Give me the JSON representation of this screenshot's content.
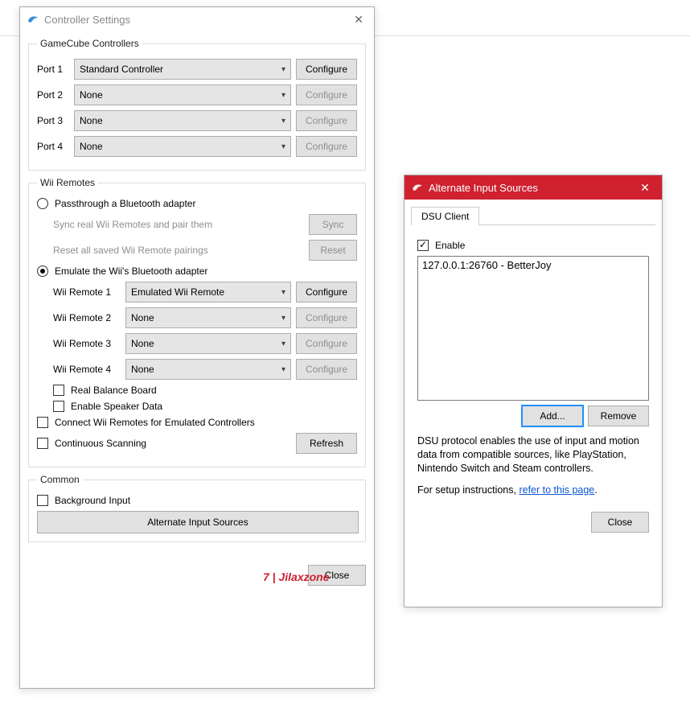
{
  "watermark": "7 | Jilaxzone",
  "leftWindow": {
    "title": "Controller Settings",
    "groups": {
      "gamecube": {
        "legend": "GameCube Controllers",
        "ports": [
          {
            "label": "Port 1",
            "value": "Standard Controller",
            "configure": "Configure",
            "enabled": true
          },
          {
            "label": "Port 2",
            "value": "None",
            "configure": "Configure",
            "enabled": false
          },
          {
            "label": "Port 3",
            "value": "None",
            "configure": "Configure",
            "enabled": false
          },
          {
            "label": "Port 4",
            "value": "None",
            "configure": "Configure",
            "enabled": false
          }
        ]
      },
      "wii": {
        "legend": "Wii Remotes",
        "passthrough": {
          "label": "Passthrough a Bluetooth adapter",
          "syncLabel": "Sync real Wii Remotes and pair them",
          "syncBtn": "Sync",
          "resetLabel": "Reset all saved Wii Remote pairings",
          "resetBtn": "Reset"
        },
        "emulate": {
          "label": "Emulate the Wii's Bluetooth adapter",
          "remotes": [
            {
              "label": "Wii Remote 1",
              "value": "Emulated Wii Remote",
              "configure": "Configure",
              "enabled": true
            },
            {
              "label": "Wii Remote 2",
              "value": "None",
              "configure": "Configure",
              "enabled": false
            },
            {
              "label": "Wii Remote 3",
              "value": "None",
              "configure": "Configure",
              "enabled": false
            },
            {
              "label": "Wii Remote 4",
              "value": "None",
              "configure": "Configure",
              "enabled": false
            }
          ],
          "balanceBoard": "Real Balance Board",
          "speakerData": "Enable Speaker Data"
        },
        "connectEmulated": "Connect Wii Remotes for Emulated Controllers",
        "continuousScanning": "Continuous Scanning",
        "refreshBtn": "Refresh"
      },
      "common": {
        "legend": "Common",
        "backgroundInput": "Background Input",
        "altInputBtn": "Alternate Input Sources"
      }
    },
    "closeBtn": "Close"
  },
  "rightWindow": {
    "title": "Alternate Input Sources",
    "tab": "DSU Client",
    "enableLabel": "Enable",
    "listItems": [
      "127.0.0.1:26760 - BetterJoy"
    ],
    "addBtn": "Add...",
    "removeBtn": "Remove",
    "desc1": "DSU protocol enables the use of input and motion data from compatible sources, like PlayStation, Nintendo Switch and Steam controllers.",
    "desc2a": "For setup instructions, ",
    "desc2Link": "refer to this page",
    "desc2b": ".",
    "closeBtn": "Close"
  }
}
